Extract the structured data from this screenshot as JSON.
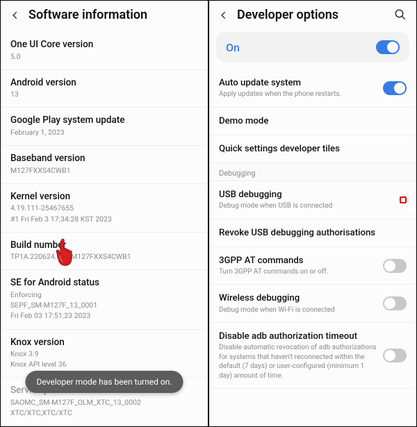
{
  "left": {
    "header": "Software information",
    "items": [
      {
        "title": "One UI Core version",
        "sub": [
          "5.0"
        ]
      },
      {
        "title": "Android version",
        "sub": [
          "13"
        ]
      },
      {
        "title": "Google Play system update",
        "sub": [
          "February 1, 2023"
        ]
      },
      {
        "title": "Baseband version",
        "sub": [
          "M127FXXS4CWB1"
        ]
      },
      {
        "title": "Kernel version",
        "sub": [
          "4.19.111-25467655",
          "#1 Fri Feb 3 17:34:28 KST 2023"
        ]
      },
      {
        "title": "Build number",
        "sub": [
          "TP1A.220624.014.M127FXXS4CWB1"
        ]
      },
      {
        "title": "SE for Android status",
        "sub": [
          "Enforcing",
          "SEPF_SM-M127F_13_0001",
          "Fri Feb 03 17:51:23 2023"
        ]
      },
      {
        "title": "Knox version",
        "sub": [
          "Knox 3.9",
          "Knox API level 36"
        ]
      },
      {
        "title": "Service provider software version",
        "sub": [
          "SAOMC_SM-M127F_OLM_XTC_13_0002",
          "XTC/XTC,XTC/XTC"
        ]
      }
    ],
    "toast": "Developer mode has been turned on."
  },
  "right": {
    "header": "Developer options",
    "main_toggle_label": "On",
    "items1": [
      {
        "title": "Auto update system",
        "sub": "Apply updates when the phone restarts.",
        "toggle": "on"
      },
      {
        "title": "Demo mode",
        "sub": "",
        "toggle": null
      },
      {
        "title": "Quick settings developer tiles",
        "sub": "",
        "toggle": null
      }
    ],
    "section": "Debugging",
    "items2": [
      {
        "title": "USB debugging",
        "sub": "Debug mode when USB is connected",
        "toggle": "off",
        "highlight": true
      },
      {
        "title": "Revoke USB debugging authorisations",
        "sub": "",
        "toggle": null
      },
      {
        "title": "3GPP AT commands",
        "sub": "Turn 3GPP AT commands on or off.",
        "toggle": "off"
      },
      {
        "title": "Wireless debugging",
        "sub": "Debug mode when Wi-Fi is connected",
        "toggle": "off"
      },
      {
        "title": "Disable adb authorization timeout",
        "sub": "Disable automatic revocation of adb authorizations for systems that haven't reconnected within the default (7 days) or user-configured (minimum 1 day) amount of time.",
        "toggle": "off"
      }
    ]
  },
  "cursor_at_item": 5
}
